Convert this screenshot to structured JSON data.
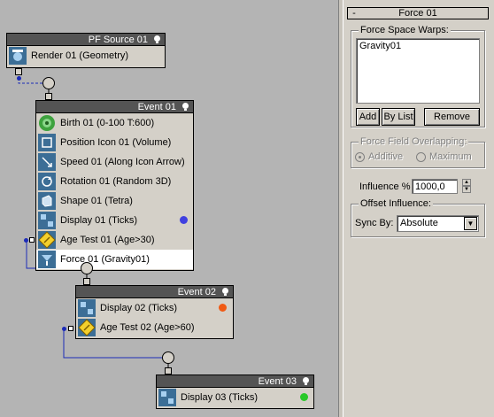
{
  "flow": {
    "source": {
      "title": "PF Source 01",
      "ops": [
        {
          "label": "Render 01 (Geometry)",
          "icon": "render-icon"
        }
      ]
    },
    "event01": {
      "title": "Event 01",
      "ops": [
        {
          "label": "Birth 01 (0-100 T:600)",
          "icon": "birth-icon"
        },
        {
          "label": "Position Icon 01 (Volume)",
          "icon": "position-icon"
        },
        {
          "label": "Speed 01 (Along Icon Arrow)",
          "icon": "speed-icon"
        },
        {
          "label": "Rotation 01 (Random 3D)",
          "icon": "rotation-icon"
        },
        {
          "label": "Shape 01 (Tetra)",
          "icon": "shape-icon"
        },
        {
          "label": "Display 01 (Ticks)",
          "icon": "display-icon",
          "color": "#4040e0"
        },
        {
          "label": "Age Test 01 (Age>30)",
          "icon": "age-test-icon"
        },
        {
          "label": "Force 01 (Gravity01)",
          "icon": "force-icon",
          "selected": true
        }
      ]
    },
    "event02": {
      "title": "Event 02",
      "ops": [
        {
          "label": "Display 02 (Ticks)",
          "icon": "display-icon",
          "color": "#f05a14"
        },
        {
          "label": "Age Test 02 (Age>60)",
          "icon": "age-test-icon"
        }
      ]
    },
    "event03": {
      "title": "Event 03",
      "ops": [
        {
          "label": "Display 03 (Ticks)",
          "icon": "display-icon",
          "color": "#28c828"
        }
      ]
    }
  },
  "panel": {
    "rollout_title": "Force 01",
    "rollout_toggle": "-",
    "space_warps": {
      "label": "Force Space Warps:",
      "items": [
        "Gravity01"
      ],
      "add": "Add",
      "by_list": "By List",
      "remove": "Remove"
    },
    "overlapping": {
      "label": "Force Field Overlapping:",
      "options": [
        "Additive",
        "Maximum"
      ],
      "selected": "Additive",
      "enabled": false
    },
    "influence": {
      "label": "Influence %",
      "value": "1000,0"
    },
    "offset": {
      "label": "Offset Influence:",
      "sync_label": "Sync By:",
      "sync_value": "Absolute"
    }
  },
  "colors": {
    "wire": "#1c2bb8",
    "canvas": "#b4b4b4",
    "title_bar": "#545454"
  }
}
